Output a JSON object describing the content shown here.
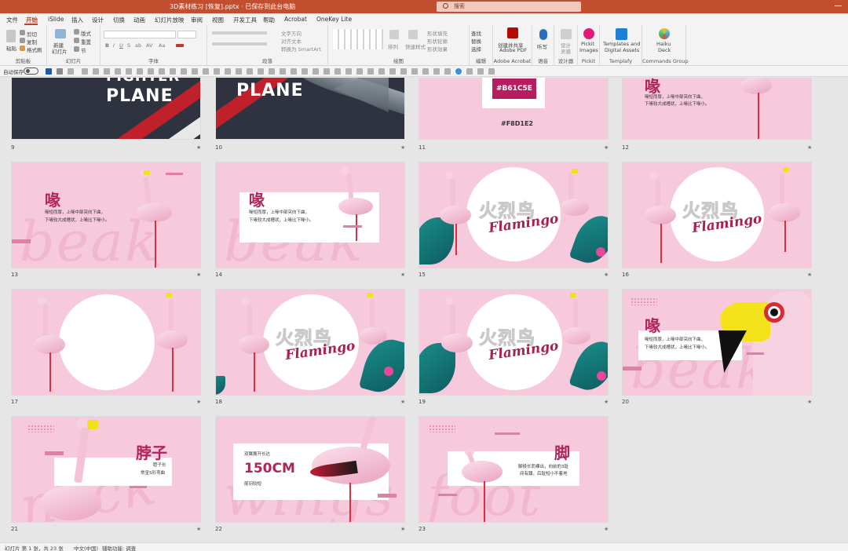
{
  "window": {
    "title": "3D素材练习 [恢复].pptx · 已保存到此台电脑",
    "search_placeholder": "搜索"
  },
  "menus": [
    "文件",
    "开始",
    "iSlide",
    "插入",
    "设计",
    "切换",
    "动画",
    "幻灯片放映",
    "审阅",
    "视图",
    "开发工具",
    "帮助",
    "Acrobat",
    "OneKey Lite"
  ],
  "active_menu": "开始",
  "ribbon": {
    "clipboard": {
      "paste": "粘贴",
      "cut": "剪切",
      "copy": "复制",
      "format_painter": "格式刷",
      "label": "剪贴板"
    },
    "slides": {
      "new": "新建\n幻灯片",
      "layout": "版式",
      "reset": "重置",
      "section": "节",
      "label": "幻灯片"
    },
    "font": {
      "label": "字体"
    },
    "paragraph": {
      "text_direction": "文字方向",
      "align_text": "对齐文本",
      "smartart": "转换为 SmartArt",
      "label": "段落"
    },
    "drawing": {
      "arrange": "排列",
      "quick_styles": "快速样式",
      "shape_fill": "形状填充",
      "shape_outline": "形状轮廓",
      "shape_effects": "形状效果",
      "label": "绘图"
    },
    "editing": {
      "find": "查找",
      "replace": "替换",
      "select": "选择",
      "label": "编辑"
    },
    "adobe": {
      "create_share": "创建并共享\nAdobe PDF",
      "label": "Adobe Acrobat"
    },
    "voice": {
      "dictate": "听写",
      "label": "语音"
    },
    "designer": {
      "design_ideas": "设计\n灵感",
      "label": "设计器"
    },
    "pickit": {
      "images": "Pickit\nImages",
      "label": "Pickit"
    },
    "templafy": {
      "templates": "Templates and\nDigital Assets",
      "label": "Templafy"
    },
    "commands": {
      "haiku": "Haiku\nDeck",
      "label": "Commands Group"
    }
  },
  "qat": {
    "autosave": "自动保存",
    "autosave_state": "关"
  },
  "slides": [
    {
      "n": "9",
      "kind": "fighter",
      "line1": "FIGHTER",
      "line2": "PLANE"
    },
    {
      "n": "10",
      "kind": "fighter-jet",
      "line2": "PLANE"
    },
    {
      "n": "11",
      "kind": "color",
      "code1": "#B61C5E",
      "code2": "#F8D1E2"
    },
    {
      "n": "12",
      "kind": "beak-top",
      "title": "喙",
      "text1": "喙短而厚，上喙中部突向下曲，",
      "text2": "下喙较大成槽状，上喙比下喙小。"
    },
    {
      "n": "13",
      "kind": "beak",
      "title": "喙",
      "text1": "喙短而厚，上喙中部突向下曲，",
      "text2": "下喙较大成槽状，上喙比下喙小。",
      "bg_word": "beak"
    },
    {
      "n": "14",
      "kind": "beak-box",
      "title": "喙",
      "text1": "喙短而厚，上喙中部突向下曲，",
      "text2": "下喙较大成槽状，上喙比下喙小。",
      "bg_word": "beak"
    },
    {
      "n": "15",
      "kind": "title-leaves",
      "title": "火烈鸟",
      "script": "Flamingo"
    },
    {
      "n": "16",
      "kind": "title-plain",
      "title": "火烈鸟",
      "script": "Flamingo"
    },
    {
      "n": "17",
      "kind": "circle-empty"
    },
    {
      "n": "18",
      "kind": "title-leaves-right",
      "title": "火烈鸟",
      "script": "Flamingo"
    },
    {
      "n": "19",
      "kind": "title-leaves",
      "title": "火烈鸟",
      "script": "Flamingo"
    },
    {
      "n": "20",
      "kind": "beak-head",
      "title": "喙",
      "text1": "喙短而厚，上喙中部突向下曲，",
      "text2": "下喙较大成槽状，上喙比下喙小。",
      "bg_word": "beak"
    },
    {
      "n": "21",
      "kind": "neck",
      "title": "脖子",
      "text1": "脖子长",
      "text2": "常呈S形弯曲",
      "bg_word": "neck"
    },
    {
      "n": "22",
      "kind": "wings",
      "small": "双翼展开长达",
      "big": "150CM",
      "tail": "尾羽较短",
      "bg_word": "wings"
    },
    {
      "n": "23",
      "kind": "foot",
      "title": "脚",
      "text1": "脚极长而裸出，向前的3趾",
      "text2": "间有蹼，后趾短小不着地",
      "bg_word": "foot"
    }
  ],
  "status": {
    "slide_info": "幻灯片 第 1 张，共 23 张",
    "language": "中文(中国)",
    "accessibility": "辅助功能: 调查"
  },
  "colors": {
    "title_bar": "#c14f2f",
    "accent": "#b7472a",
    "slide_pink": "#f6c9dc",
    "brand_red": "#b61c5e"
  }
}
